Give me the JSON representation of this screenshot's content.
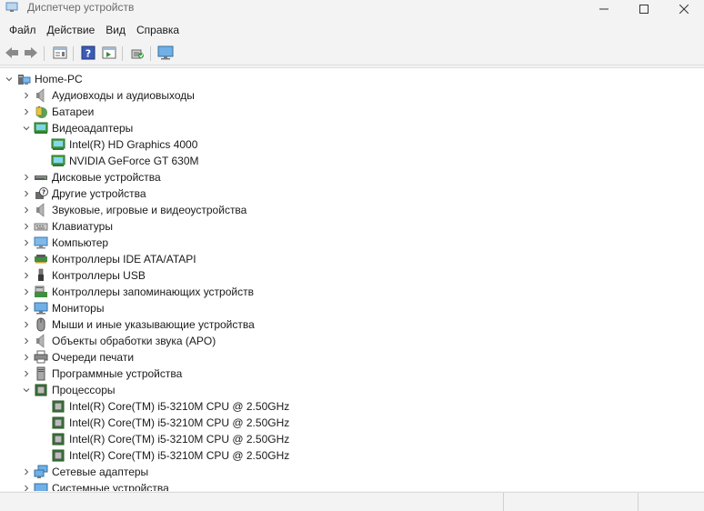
{
  "window": {
    "title": "Диспетчер устройств",
    "minimize_icon": "minimize-icon",
    "maximize_icon": "maximize-icon",
    "close_icon": "close-icon"
  },
  "menu": {
    "items": [
      "Файл",
      "Действие",
      "Вид",
      "Справка"
    ]
  },
  "toolbar": {
    "buttons": [
      "back-icon",
      "forward-icon",
      "properties-icon",
      "help-icon",
      "view-icon",
      "scan-hardware-icon",
      "monitor-icon"
    ]
  },
  "tree": {
    "root": "Home-PC",
    "items": [
      {
        "label": "Аудиовходы и аудиовыходы",
        "icon": "speaker-icon",
        "expanded": false
      },
      {
        "label": "Батареи",
        "icon": "battery-icon",
        "expanded": false
      },
      {
        "label": "Видеоадаптеры",
        "icon": "display-adapter-icon",
        "expanded": true,
        "children": [
          "Intel(R) HD Graphics 4000",
          "NVIDIA GeForce GT 630M"
        ]
      },
      {
        "label": "Дисковые устройства",
        "icon": "disk-drive-icon",
        "expanded": false
      },
      {
        "label": "Другие устройства",
        "icon": "unknown-device-icon",
        "expanded": false
      },
      {
        "label": "Звуковые, игровые и видеоустройства",
        "icon": "speaker-icon",
        "expanded": false
      },
      {
        "label": "Клавиатуры",
        "icon": "keyboard-icon",
        "expanded": false
      },
      {
        "label": "Компьютер",
        "icon": "computer-icon",
        "expanded": false
      },
      {
        "label": "Контроллеры IDE ATA/ATAPI",
        "icon": "ide-controller-icon",
        "expanded": false
      },
      {
        "label": "Контроллеры USB",
        "icon": "usb-icon",
        "expanded": false
      },
      {
        "label": "Контроллеры запоминающих устройств",
        "icon": "storage-controller-icon",
        "expanded": false
      },
      {
        "label": "Мониторы",
        "icon": "monitor-icon",
        "expanded": false
      },
      {
        "label": "Мыши и иные указывающие устройства",
        "icon": "mouse-icon",
        "expanded": false
      },
      {
        "label": "Объекты обработки звука (APO)",
        "icon": "speaker-icon",
        "expanded": false
      },
      {
        "label": "Очереди печати",
        "icon": "printer-icon",
        "expanded": false
      },
      {
        "label": "Программные устройства",
        "icon": "software-device-icon",
        "expanded": false
      },
      {
        "label": "Процессоры",
        "icon": "processor-icon",
        "expanded": true,
        "children": [
          "Intel(R) Core(TM) i5-3210M CPU @ 2.50GHz",
          "Intel(R) Core(TM) i5-3210M CPU @ 2.50GHz",
          "Intel(R) Core(TM) i5-3210M CPU @ 2.50GHz",
          "Intel(R) Core(TM) i5-3210M CPU @ 2.50GHz"
        ]
      },
      {
        "label": "Сетевые адаптеры",
        "icon": "network-adapter-icon",
        "expanded": false
      },
      {
        "label": "Системные устройства",
        "icon": "system-device-icon",
        "expanded": false
      }
    ]
  },
  "colors": {
    "accent": "#0078d4",
    "tree_bg": "#ffffff",
    "chrome_bg": "#f3f3f3"
  }
}
